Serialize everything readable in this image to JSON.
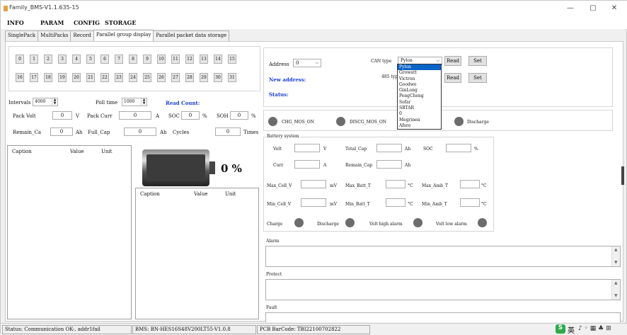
{
  "window": {
    "title": "Family_BMS-V1.1.635-15",
    "minimize": "—",
    "maximize": "▢",
    "close": "✕"
  },
  "menu": [
    "INFO",
    "PARAM",
    "CONFIG",
    "STORAGE"
  ],
  "tabs": [
    "SinglePack",
    "MultiPacks",
    "Record",
    "Parallel group display",
    "Parallel packet data storage"
  ],
  "pack_buttons_row1": [
    "0",
    "1",
    "2",
    "3",
    "4",
    "5",
    "6",
    "7",
    "8",
    "9",
    "10",
    "11",
    "12",
    "13",
    "14",
    "15"
  ],
  "pack_buttons_row2": [
    "16",
    "17",
    "18",
    "19",
    "20",
    "21",
    "22",
    "23",
    "24",
    "25",
    "26",
    "27",
    "28",
    "29",
    "30",
    "31"
  ],
  "intervals": {
    "label": "Intervals",
    "value": "4000"
  },
  "poll_time": {
    "label": "Poll time",
    "value": "1000"
  },
  "read_count": {
    "label": "Read Count:"
  },
  "pack_row": {
    "pack_volt_label": "Pack Volt",
    "pack_volt_value": "0",
    "pack_volt_unit": "V",
    "pack_curr_label": "Pack Curr",
    "pack_curr_value": "0",
    "pack_curr_unit": "A",
    "soc_label": "SOC",
    "soc_value": "0",
    "soc_unit": "%",
    "soh_label": "SOH",
    "soh_value": "0",
    "soh_unit": "%"
  },
  "cap_row": {
    "remain_label": "Remain_Ca",
    "remain_value": "0",
    "remain_unit": "Ah",
    "full_label": "Full_Cap",
    "full_value": "0",
    "full_unit": "Ah",
    "cycles_label": "Cycles",
    "cycles_value": "0",
    "cycles_unit": "Times"
  },
  "grid_left": {
    "headers": [
      "Caption",
      "Value",
      "Unit"
    ]
  },
  "grid_mid": {
    "headers": [
      "Caption",
      "Value",
      "Unit"
    ]
  },
  "battery_percent": "0 %",
  "address": {
    "label": "Address",
    "value": "0"
  },
  "new_address": {
    "label": "New address:"
  },
  "status": {
    "label": "Status:"
  },
  "can_type": {
    "label": "CAN type",
    "value": "Pylon",
    "options": [
      "Pylon",
      "Growatt",
      "Victron",
      "Goodwe",
      "GinLong",
      "PengCheng",
      "Sofar",
      "SRTAR",
      "0",
      "Megrinen",
      "Afore"
    ]
  },
  "rs485_type": {
    "label": "485 type"
  },
  "buttons": {
    "read1": "Read",
    "set1": "Set",
    "read2": "Read",
    "set2": "Set"
  },
  "mos": {
    "chg": "CHG_MOS_ON",
    "dischg": "DISCG_MOS_ON",
    "discharge": "Discharge"
  },
  "battery_system": {
    "title": "Battery system",
    "volt_label": "Volt",
    "volt_unit": "V",
    "total_cap_label": "Total_Cap",
    "total_cap_unit": "Ah",
    "soc_label": "SOC",
    "soc_unit": "%",
    "curr_label": "Curr",
    "curr_unit": "A",
    "remain_cap_label": "Remain_Cap",
    "remain_cap_unit": "Ah",
    "max_cell_label": "Max_Cell_V",
    "max_cell_unit": "mV",
    "max_batt_t_label": "Max_Batt_T",
    "max_batt_t_unit": "°C",
    "max_amb_t_label": "Max_Amb_T",
    "max_amb_t_unit": "°C",
    "min_cell_label": "Min_Cell_V",
    "min_cell_unit": "mV",
    "min_batt_t_label": "Min_Batt_T",
    "min_batt_t_unit": "°C",
    "min_amb_t_label": "Min_Amb_T",
    "min_amb_t_unit": "°C",
    "charge_label": "Charge",
    "discharge_label": "Discharge",
    "volt_high_label": "Volt high alarm",
    "volt_low_label": "Volt low alarm"
  },
  "alarm": {
    "label": "Alarm"
  },
  "protect": {
    "label": "Protect"
  },
  "fault": {
    "label": "Fault"
  },
  "statusbar": {
    "status": "Status: Communication OK-, addr1fail",
    "bms": "BMS: BN-HES16S48V200LT55-V1.0.8",
    "pcb": "PCB BarCode: TBI22100702822"
  },
  "tray": {
    "ime": "S",
    "lang": "英",
    "icons": "♪ ◦ ▦ ♣ ⊞"
  }
}
